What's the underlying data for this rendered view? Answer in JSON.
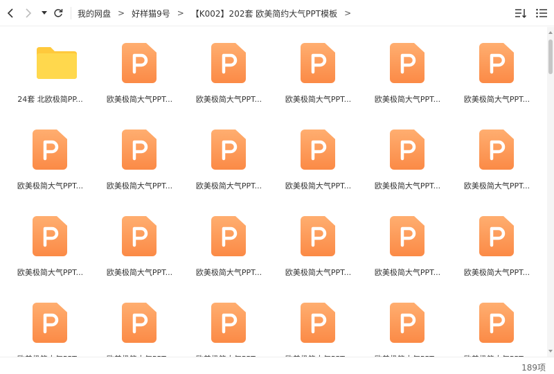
{
  "toolbar": {
    "breadcrumb": [
      {
        "label": "我的网盘"
      },
      {
        "label": "好样猫9号"
      },
      {
        "label": "【K002】202套 欧美简约大气PPT模板"
      }
    ],
    "separator": ">"
  },
  "files": [
    {
      "name": "24套 北欧极简PP...",
      "type": "folder"
    },
    {
      "name": "欧美极简大气PPT...",
      "type": "ppt"
    },
    {
      "name": "欧美极简大气PPT...",
      "type": "ppt"
    },
    {
      "name": "欧美极简大气PPT...",
      "type": "ppt"
    },
    {
      "name": "欧美极简大气PPT...",
      "type": "ppt"
    },
    {
      "name": "欧美极简大气PPT...",
      "type": "ppt"
    },
    {
      "name": "欧美极简大气PPT...",
      "type": "ppt"
    },
    {
      "name": "欧美极简大气PPT...",
      "type": "ppt"
    },
    {
      "name": "欧美极简大气PPT...",
      "type": "ppt"
    },
    {
      "name": "欧美极简大气PPT...",
      "type": "ppt"
    },
    {
      "name": "欧美极简大气PPT...",
      "type": "ppt"
    },
    {
      "name": "欧美极简大气PPT...",
      "type": "ppt"
    },
    {
      "name": "欧美极简大气PPT...",
      "type": "ppt"
    },
    {
      "name": "欧美极简大气PPT...",
      "type": "ppt"
    },
    {
      "name": "欧美极简大气PPT...",
      "type": "ppt"
    },
    {
      "name": "欧美极简大气PPT...",
      "type": "ppt"
    },
    {
      "name": "欧美极简大气PPT...",
      "type": "ppt"
    },
    {
      "name": "欧美极简大气PPT...",
      "type": "ppt"
    },
    {
      "name": "欧美极简大气PPT...",
      "type": "ppt"
    },
    {
      "name": "欧美极简大气PPT...",
      "type": "ppt"
    },
    {
      "name": "欧美极简大气PPT...",
      "type": "ppt"
    },
    {
      "name": "欧美极简大气PPT...",
      "type": "ppt"
    },
    {
      "name": "欧美极简大气PPT...",
      "type": "ppt"
    },
    {
      "name": "欧美极简大气PPT...",
      "type": "ppt"
    }
  ],
  "status": {
    "count": "189项"
  },
  "colors": {
    "ppt_orange": "#fb8a46",
    "folder_yellow": "#ffd84d"
  }
}
